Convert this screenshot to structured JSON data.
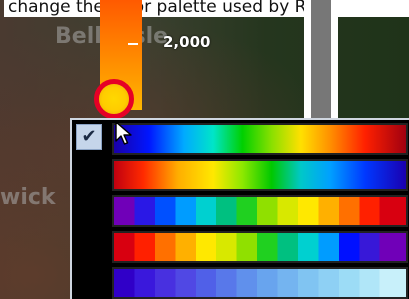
{
  "caption": "change the color palette used by Righ",
  "map_labels": [
    "Belle Isle",
    "wick"
  ],
  "colorbar": {
    "tick_label": "2,000"
  },
  "palette_popup": {
    "selected_index": 0,
    "checkmark": "✔",
    "palettes": [
      "palette-1",
      "palette-2",
      "palette-3",
      "palette-4",
      "palette-5"
    ]
  },
  "colors": {
    "handle_ring": "#e60026",
    "handle_fill": "#ffcc00",
    "check_bg": "#c5d5ea"
  }
}
